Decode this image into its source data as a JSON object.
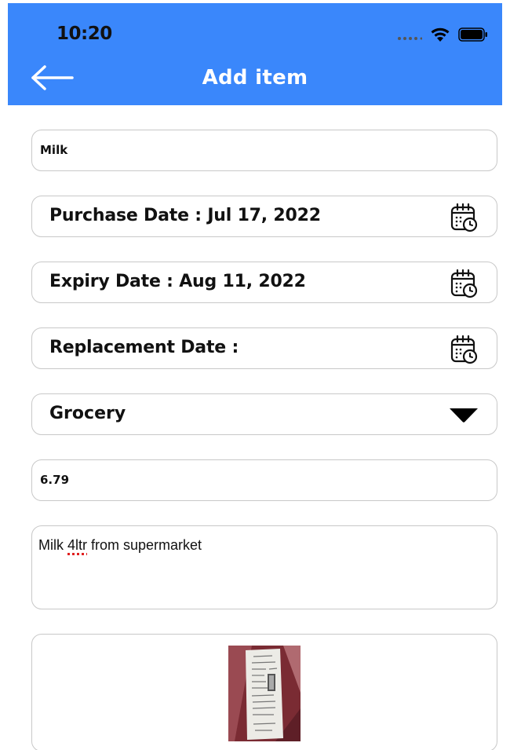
{
  "status_bar": {
    "time": "10:20",
    "icons": [
      "signal-dots-icon",
      "wifi-icon",
      "battery-icon"
    ]
  },
  "header": {
    "title": "Add item",
    "back_icon": "arrow-left-icon",
    "background_color": "#3a87fb"
  },
  "form": {
    "name_value": "Milk",
    "purchase_date": "Purchase Date : Jul 17, 2022",
    "expiry_date": "Expiry Date : Aug 11, 2022",
    "replacement_date": "Replacement Date :",
    "calendar_icon": "calendar-clock-icon",
    "category_selected": "Grocery",
    "dropdown_icon": "triangle-down-icon",
    "price_value": "6.79",
    "notes_before": "Milk ",
    "notes_misspelled": "4ltr",
    "notes_after": " from supermarket",
    "image_icon": "receipt-photo"
  }
}
